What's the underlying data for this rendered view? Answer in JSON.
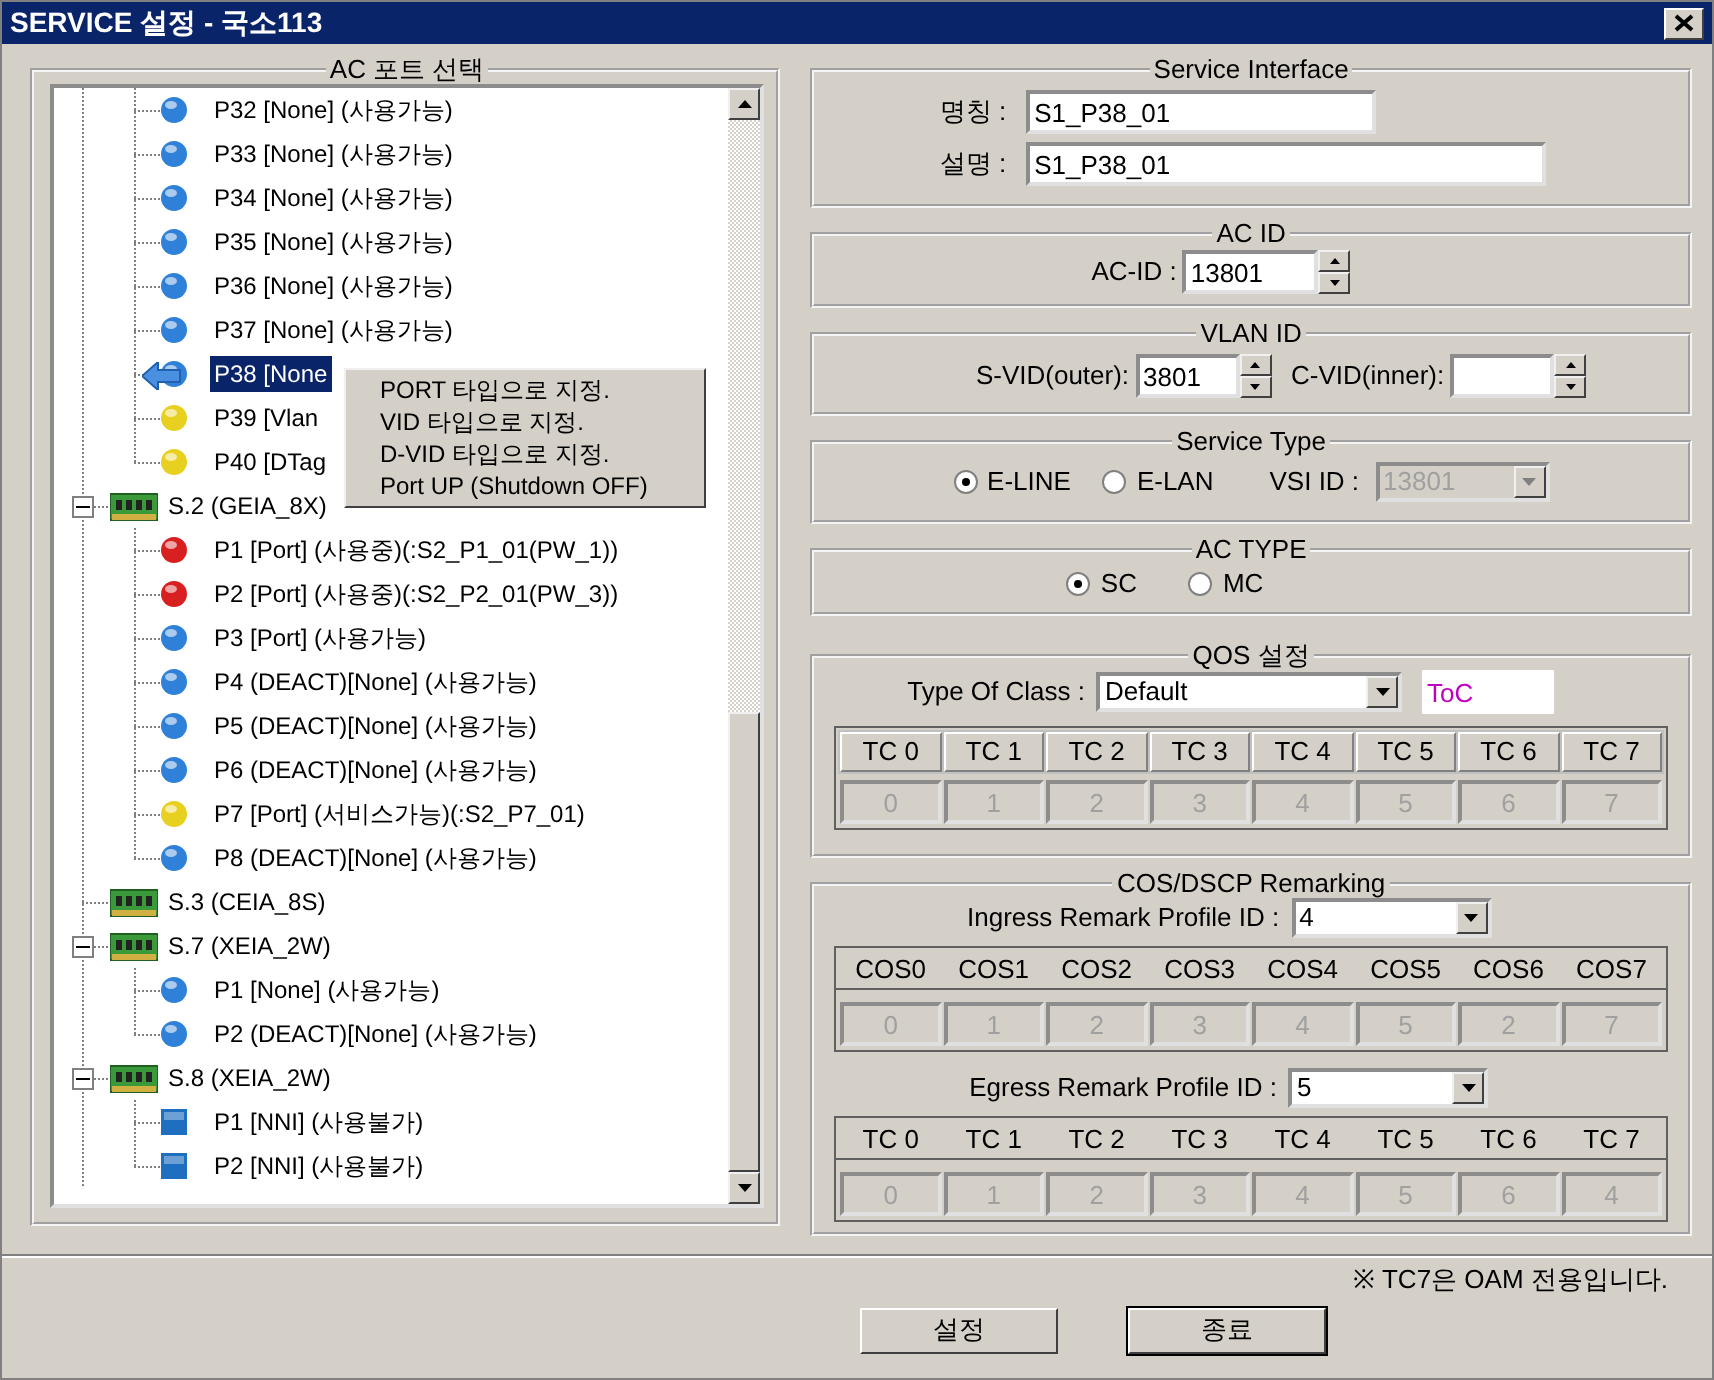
{
  "window": {
    "title": "SERVICE 설정 - 국소113"
  },
  "port_select": {
    "title": "AC 포트 선택",
    "tree": [
      {
        "children": [
          {
            "label": "P32 [None] (사용가능)",
            "kind": "ball",
            "color": "#2f80d8",
            "selected": false
          },
          {
            "label": "P33 [None] (사용가능)",
            "kind": "ball",
            "color": "#2f80d8",
            "selected": false
          },
          {
            "label": "P34 [None] (사용가능)",
            "kind": "ball",
            "color": "#2f80d8",
            "selected": false
          },
          {
            "label": "P35 [None] (사용가능)",
            "kind": "ball",
            "color": "#2f80d8",
            "selected": false
          },
          {
            "label": "P36 [None] (사용가능)",
            "kind": "ball",
            "color": "#2f80d8",
            "selected": false
          },
          {
            "label": "P37 [None] (사용가능)",
            "kind": "ball",
            "color": "#2f80d8",
            "selected": false
          },
          {
            "label": "P38 [None",
            "kind": "ball",
            "color": "#2f80d8",
            "selected": true
          },
          {
            "label": "P39 [Vlan",
            "kind": "ball",
            "color": "#e8d020",
            "selected": false
          },
          {
            "label": "P40 [DTag",
            "kind": "ball",
            "color": "#e8d020",
            "selected": false
          }
        ]
      },
      {
        "label": "S.2 (GEIA_8X)",
        "kind": "slot",
        "expanded": true,
        "selected": false,
        "children": [
          {
            "label": "P1 [Port] (사용중)(:S2_P1_01(PW_1))",
            "kind": "ball",
            "color": "#d82020",
            "selected": false
          },
          {
            "label": "P2 [Port] (사용중)(:S2_P2_01(PW_3))",
            "kind": "ball",
            "color": "#d82020",
            "selected": false
          },
          {
            "label": "P3 [Port] (사용가능)",
            "kind": "ball",
            "color": "#2f80d8",
            "selected": false
          },
          {
            "label": "P4 (DEACT)[None] (사용가능)",
            "kind": "ball",
            "color": "#2f80d8",
            "selected": false
          },
          {
            "label": "P5 (DEACT)[None] (사용가능)",
            "kind": "ball",
            "color": "#2f80d8",
            "selected": false
          },
          {
            "label": "P6 (DEACT)[None] (사용가능)",
            "kind": "ball",
            "color": "#2f80d8",
            "selected": false
          },
          {
            "label": "P7 [Port] (서비스가능)(:S2_P7_01)",
            "kind": "ball",
            "color": "#e8d020",
            "selected": false
          },
          {
            "label": "P8 (DEACT)[None] (사용가능)",
            "kind": "ball",
            "color": "#2f80d8",
            "selected": false
          }
        ]
      },
      {
        "label": "S.3 (CEIA_8S)",
        "kind": "slot",
        "selected": false
      },
      {
        "label": "S.7 (XEIA_2W)",
        "kind": "slot",
        "expanded": true,
        "selected": false,
        "children": [
          {
            "label": "P1 [None] (사용가능)",
            "kind": "ball",
            "color": "#2f80d8",
            "selected": false
          },
          {
            "label": "P2 (DEACT)[None] (사용가능)",
            "kind": "ball",
            "color": "#2f80d8",
            "selected": false
          }
        ]
      },
      {
        "label": "S.8 (XEIA_2W)",
        "kind": "slot",
        "expanded": true,
        "selected": false,
        "children": [
          {
            "label": "P1 [NNI] (사용불가)",
            "kind": "square",
            "color": "#1f6fc0",
            "selected": false
          },
          {
            "label": "P2 [NNI] (사용불가)",
            "kind": "square",
            "color": "#1f6fc0",
            "selected": false
          }
        ]
      }
    ]
  },
  "context_menu": {
    "items": [
      "PORT 타입으로 지정.",
      "VID 타입으로 지정.",
      "D-VID 타입으로 지정.",
      "Port UP (Shutdown OFF)"
    ]
  },
  "service_interface": {
    "title": "Service Interface",
    "name_label": "명칭 :",
    "name_value": "S1_P38_01",
    "desc_label": "설명 :",
    "desc_value": "S1_P38_01"
  },
  "ac_id": {
    "title": "AC ID",
    "label": "AC-ID :",
    "value": "13801"
  },
  "vlan_id": {
    "title": "VLAN ID",
    "s_vid_label": "S-VID(outer):",
    "s_vid_value": "3801",
    "c_vid_label": "C-VID(inner):"
  },
  "service_type": {
    "title": "Service Type",
    "options": [
      {
        "label": "E-LINE",
        "selected": true
      },
      {
        "label": "E-LAN",
        "selected": false
      }
    ],
    "vsi_label": "VSI ID :",
    "vsi_value": "13801",
    "vsi_disabled": true
  },
  "ac_type": {
    "title": "AC TYPE",
    "options": [
      {
        "label": "SC",
        "selected": true
      },
      {
        "label": "MC",
        "selected": false
      }
    ]
  },
  "qos": {
    "title": "QOS 설정",
    "type_label": "Type Of Class :",
    "type_value": "Default",
    "toc_value": "ToC",
    "table": {
      "kind": "boxed",
      "columns": [
        "TC 0",
        "TC 1",
        "TC 2",
        "TC 3",
        "TC 4",
        "TC 5",
        "TC 6",
        "TC 7"
      ],
      "values": [
        "0",
        "1",
        "2",
        "3",
        "4",
        "5",
        "6",
        "7"
      ]
    }
  },
  "remarking": {
    "title": "COS/DSCP Remarking",
    "ingress_label": "Ingress Remark Profile ID :",
    "ingress_value": "4",
    "ingress_table": {
      "kind": "plain",
      "columns": [
        "COS0",
        "COS1",
        "COS2",
        "COS3",
        "COS4",
        "COS5",
        "COS6",
        "COS7"
      ],
      "values": [
        "0",
        "1",
        "2",
        "3",
        "4",
        "5",
        "2",
        "7"
      ]
    },
    "egress_label": "Egress Remark Profile ID :",
    "egress_value": "5",
    "egress_table": {
      "kind": "plain",
      "columns": [
        "TC 0",
        "TC 1",
        "TC 2",
        "TC 3",
        "TC 4",
        "TC 5",
        "TC 6",
        "TC 7"
      ],
      "values": [
        "0",
        "1",
        "2",
        "3",
        "4",
        "5",
        "6",
        "4"
      ]
    }
  },
  "note": "※ TC7은 OAM 전용입니다.",
  "buttons": [
    {
      "label": "설정",
      "default": false
    },
    {
      "label": "종료",
      "default": true
    }
  ]
}
